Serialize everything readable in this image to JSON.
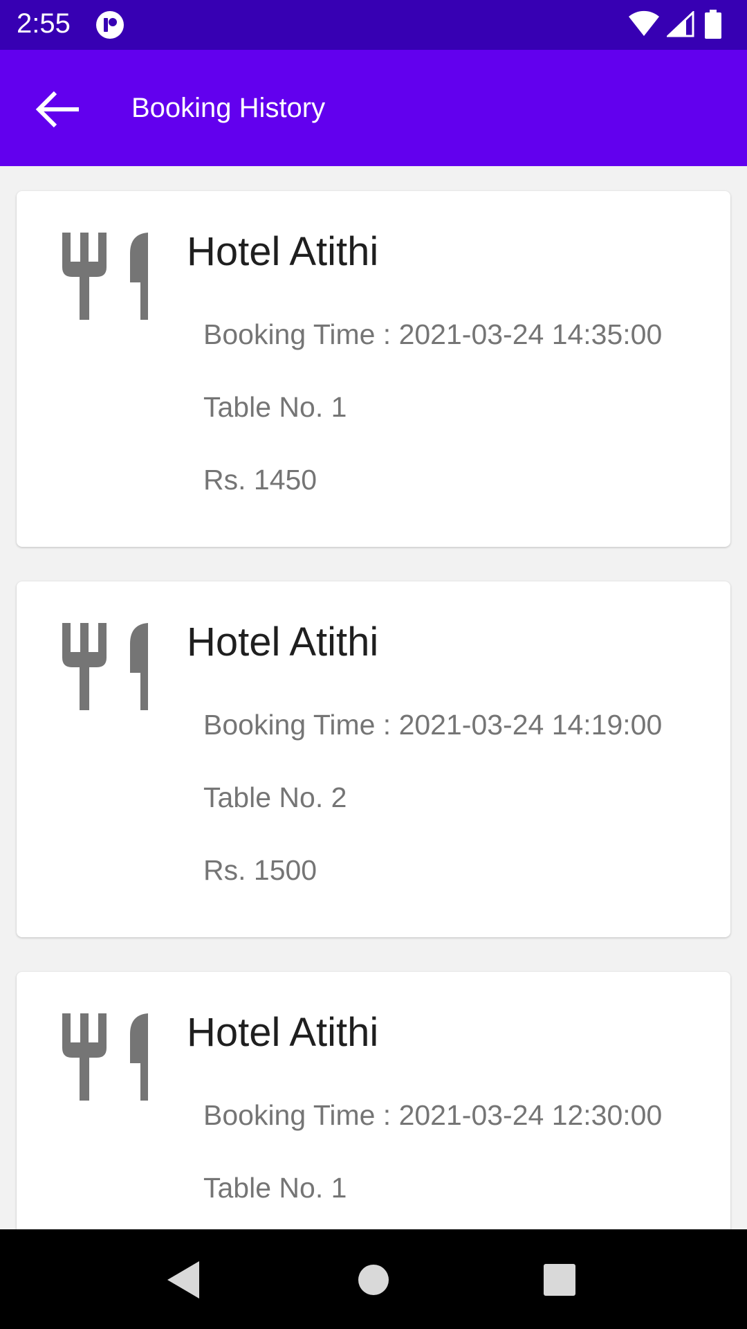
{
  "status_bar": {
    "time": "2:55"
  },
  "app_bar": {
    "title": "Booking History"
  },
  "bookings": [
    {
      "hotel": "Hotel Atithi",
      "booking_time": "Booking Time : 2021-03-24 14:35:00",
      "table": "Table No. 1",
      "price": "Rs. 1450"
    },
    {
      "hotel": "Hotel Atithi",
      "booking_time": "Booking Time : 2021-03-24 14:19:00",
      "table": "Table No. 2",
      "price": "Rs. 1500"
    },
    {
      "hotel": "Hotel Atithi",
      "booking_time": "Booking Time : 2021-03-24 12:30:00",
      "table": "Table No. 1",
      "price": ""
    }
  ],
  "icons": {
    "restaurant": "restaurant-icon",
    "back": "arrow-back-icon",
    "wifi": "wifi-icon",
    "signal": "cell-signal-icon",
    "battery": "battery-icon"
  },
  "colors": {
    "status_bar": "#3700b3",
    "app_bar": "#6200ee",
    "background": "#f2f2f2",
    "icon_gray": "#757575"
  }
}
